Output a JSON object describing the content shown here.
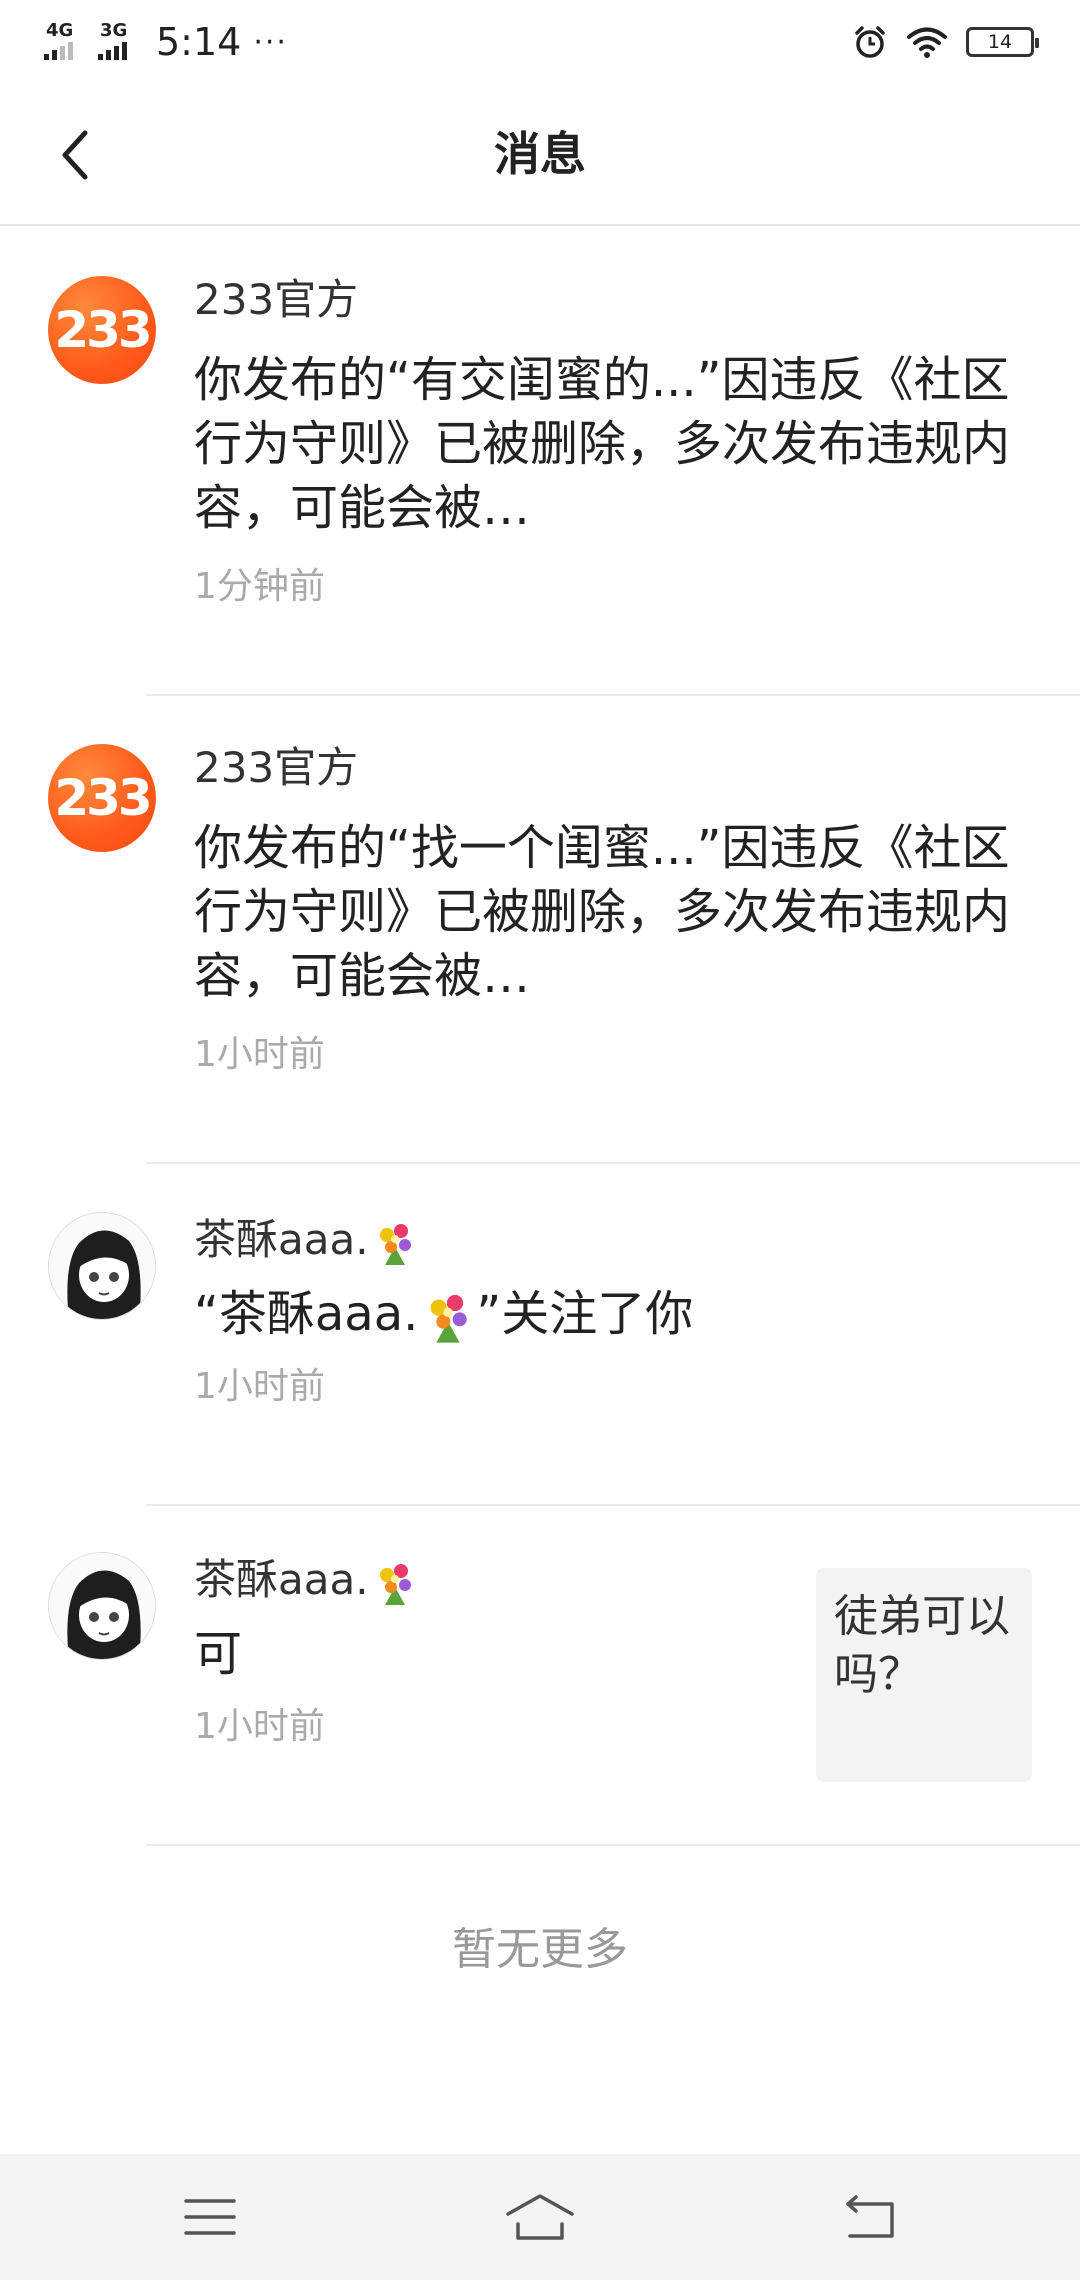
{
  "status_bar": {
    "network1": "4G",
    "network2": "3G",
    "time": "5:14",
    "more": "···",
    "battery": "14"
  },
  "header": {
    "title": "消息",
    "back_icon": "chevron-left-icon"
  },
  "messages": [
    {
      "sender": "233官方",
      "avatar_text": "233",
      "text": "你发布的“有交闺蜜的...”因违反《社区行为守则》已被删除，多次发布违规内容，可能会被…",
      "time": "1分钟前"
    },
    {
      "sender": "233官方",
      "avatar_text": "233",
      "text": "你发布的“找一个闺蜜...”因违反《社区行为守则》已被删除，多次发布违规内容，可能会被…",
      "time": "1小时前"
    },
    {
      "sender": "茶酥aaa.",
      "text_before": "“茶酥aaa.",
      "text_after": "”关注了你",
      "time": "1小时前"
    },
    {
      "sender": "茶酥aaa.",
      "text": "可",
      "time": "1小时前",
      "quote": "徒弟可以吗？"
    }
  ],
  "footer_text": "暂无更多",
  "bottom_nav": {
    "menu_icon": "menu-icon",
    "home_icon": "home-icon",
    "back_icon": "back-icon"
  },
  "colors": {
    "accent": "#ff5a1a",
    "muted": "#aaaaaa"
  }
}
